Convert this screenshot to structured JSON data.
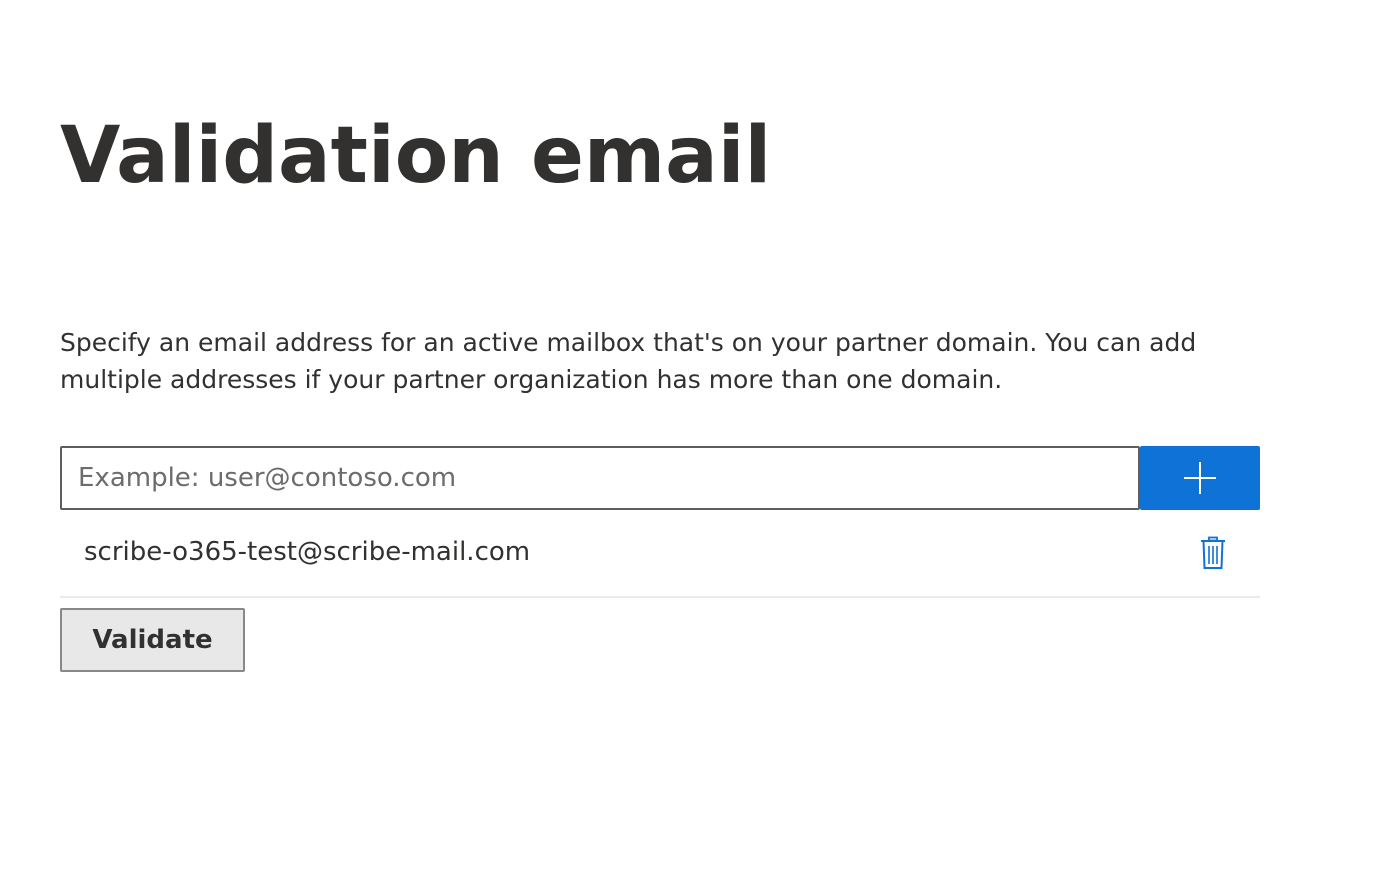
{
  "page": {
    "title": "Validation email",
    "description": "Specify an email address for an active mailbox that's on your partner domain. You can add multiple addresses if your partner organization has more than one domain."
  },
  "email_input": {
    "value": "",
    "placeholder": "Example: user@contoso.com"
  },
  "add_button": {
    "icon": "plus-icon",
    "color": "#0f72d6"
  },
  "email_list": [
    {
      "address": "scribe-o365-test@scribe-mail.com",
      "delete_icon": "trash-icon"
    }
  ],
  "validate_button": {
    "label": "Validate"
  },
  "colors": {
    "accent": "#0f72d6",
    "text": "#323130",
    "divider": "#edebe9"
  }
}
